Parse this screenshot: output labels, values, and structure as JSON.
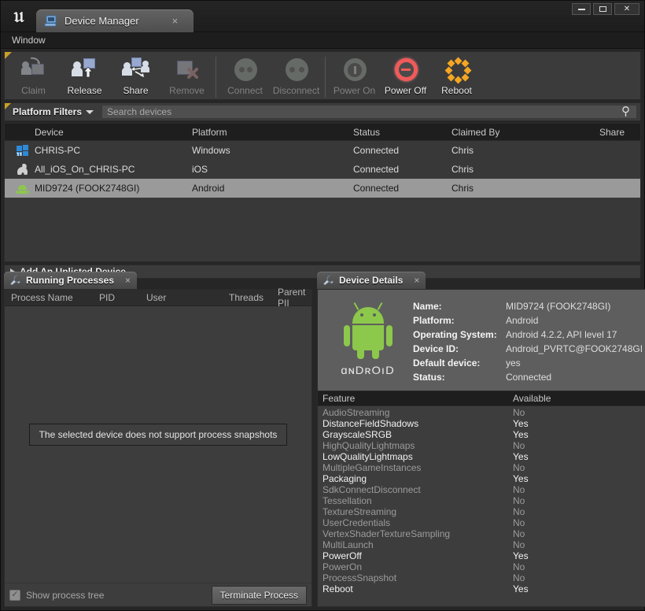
{
  "window": {
    "tab_title": "Device Manager",
    "tab_icon": "device-manager-icon",
    "close_glyph": "×",
    "minimize_label": "Minimize",
    "maximize_label": "Maximize",
    "close_label": "Close"
  },
  "menubar": {
    "items": [
      {
        "label": "Window"
      }
    ]
  },
  "toolbar": {
    "buttons": [
      {
        "label": "Claim",
        "icon": "claim-icon",
        "enabled": false
      },
      {
        "label": "Release",
        "icon": "release-icon",
        "enabled": true
      },
      {
        "label": "Share",
        "icon": "share-icon",
        "enabled": true
      },
      {
        "label": "Remove",
        "icon": "remove-icon",
        "enabled": false
      },
      {
        "label": "Connect",
        "icon": "connect-icon",
        "enabled": false
      },
      {
        "label": "Disconnect",
        "icon": "disconnect-icon",
        "enabled": false
      },
      {
        "label": "Power On",
        "icon": "power-on-icon",
        "enabled": false
      },
      {
        "label": "Power Off",
        "icon": "power-off-icon",
        "enabled": true
      },
      {
        "label": "Reboot",
        "icon": "reboot-icon",
        "enabled": true
      }
    ]
  },
  "filterbar": {
    "platform_filters_label": "Platform Filters",
    "search_placeholder": "Search devices",
    "search_value": "",
    "search_icon": "search-icon"
  },
  "device_table": {
    "columns": [
      "Device",
      "Platform",
      "Status",
      "Claimed By",
      "Share"
    ],
    "rows": [
      {
        "icon": "windows-icon",
        "device": "CHRIS-PC",
        "platform": "Windows",
        "status": "Connected",
        "claimed_by": "Chris",
        "shared": false,
        "selected": false
      },
      {
        "icon": "apple-icon",
        "device": "All_iOS_On_CHRIS-PC",
        "platform": "iOS",
        "status": "Connected",
        "claimed_by": "Chris",
        "shared": false,
        "selected": false
      },
      {
        "icon": "android-icon",
        "device": "MID9724 (FOOK2748GI)",
        "platform": "Android",
        "status": "Connected",
        "claimed_by": "Chris",
        "shared": true,
        "selected": true
      }
    ]
  },
  "add_device": {
    "label": "Add An Unlisted Device",
    "expander_icon": "chevron-right-icon"
  },
  "processes": {
    "tab_title": "Running Processes",
    "tab_icon": "wrench-icon",
    "close_glyph": "×",
    "columns": [
      "Process Name",
      "PID",
      "User",
      "Threads",
      "Parent PII"
    ],
    "rows": [],
    "empty_notice": "The selected device does not support process snapshots",
    "show_process_tree_label": "Show process tree",
    "show_process_tree_checked": true,
    "terminate_label": "Terminate Process"
  },
  "details": {
    "tab_title": "Device Details",
    "tab_icon": "wrench-icon",
    "close_glyph": "×",
    "logo_icon": "android-robot-icon",
    "logo_wordmark": "ɑɴDʀOıD",
    "fields": [
      {
        "key": "Name:",
        "value": "MID9724 (FOOK2748GI)"
      },
      {
        "key": "Platform:",
        "value": "Android"
      },
      {
        "key": "Operating System:",
        "value": "Android 4.2.2, API level 17"
      },
      {
        "key": "Device ID:",
        "value": "Android_PVRTC@FOOK2748GI"
      },
      {
        "key": "Default device:",
        "value": "yes"
      },
      {
        "key": "Status:",
        "value": "Connected"
      }
    ],
    "feature_columns": [
      "Feature",
      "Available"
    ],
    "features": [
      {
        "name": "AudioStreaming",
        "available": "No"
      },
      {
        "name": "DistanceFieldShadows",
        "available": "Yes"
      },
      {
        "name": "GrayscaleSRGB",
        "available": "Yes"
      },
      {
        "name": "HighQualityLightmaps",
        "available": "No"
      },
      {
        "name": "LowQualityLightmaps",
        "available": "Yes"
      },
      {
        "name": "MultipleGameInstances",
        "available": "No"
      },
      {
        "name": "Packaging",
        "available": "Yes"
      },
      {
        "name": "SdkConnectDisconnect",
        "available": "No"
      },
      {
        "name": "Tessellation",
        "available": "No"
      },
      {
        "name": "TextureStreaming",
        "available": "No"
      },
      {
        "name": "UserCredentials",
        "available": "No"
      },
      {
        "name": "VertexShaderTextureSampling",
        "available": "No"
      },
      {
        "name": "MultiLaunch",
        "available": "No"
      },
      {
        "name": "PowerOff",
        "available": "Yes"
      },
      {
        "name": "PowerOn",
        "available": "No"
      },
      {
        "name": "ProcessSnapshot",
        "available": "No"
      },
      {
        "name": "Reboot",
        "available": "Yes"
      }
    ]
  },
  "colors": {
    "accent_yellow": "#c8a02a",
    "android_green": "#8cc84b",
    "power_off_red": "#f05a5a",
    "reboot_orange": "#f5a623",
    "windows_blue": "#2d8ad8",
    "selection_gray": "#9a9a9a"
  }
}
